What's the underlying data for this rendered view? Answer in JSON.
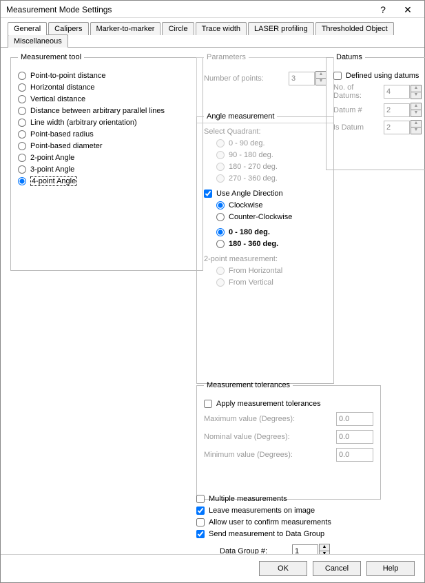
{
  "window": {
    "title": "Measurement Mode Settings",
    "help": "?",
    "close": "✕"
  },
  "tabs": [
    "General",
    "Calipers",
    "Marker-to-marker",
    "Circle",
    "Trace width",
    "LASER profiling",
    "Thresholded Object",
    "Miscellaneous"
  ],
  "tool": {
    "legend": "Measurement tool",
    "options": [
      "Point-to-point distance",
      "Horizontal distance",
      "Vertical distance",
      "Distance between arbitrary parallel lines",
      "Line width (arbitrary orientation)",
      "Point-based radius",
      "Point-based diameter",
      "2-point Angle",
      "3-point Angle",
      "4-point Angle"
    ],
    "selected": "4-point Angle"
  },
  "params": {
    "legend": "Parameters",
    "num_points_label": "Number of points:",
    "num_points": "3"
  },
  "datums": {
    "legend": "Datums",
    "use_label": "Defined using datums",
    "rows": [
      {
        "label": "No. of Datums:",
        "value": "4"
      },
      {
        "label": "Datum #",
        "value": "2"
      },
      {
        "label": "Is Datum",
        "value": "2"
      }
    ]
  },
  "angle": {
    "legend": "Angle measurement",
    "quadrant_label": "Select Quadrant:",
    "quadrants": [
      "0 - 90 deg.",
      "90 - 180 deg.",
      "180 - 270 deg.",
      "270 - 360 deg."
    ],
    "use_dir_label": "Use Angle Direction",
    "use_dir": true,
    "dir_options": [
      "Clockwise",
      "Counter-Clockwise"
    ],
    "dir_selected": "Clockwise",
    "range_options": [
      "0 - 180 deg.",
      "180 - 360 deg."
    ],
    "range_selected": "0 - 180 deg.",
    "two_pt_label": "2-point measurement:",
    "two_pt_options": [
      "From Horizontal",
      "From Vertical"
    ]
  },
  "tol": {
    "legend": "Measurement tolerances",
    "apply_label": "Apply measurement tolerances",
    "rows": [
      {
        "label": "Maximum value (Degrees):",
        "value": "0.0"
      },
      {
        "label": "Nominal value (Degrees):",
        "value": "0.0"
      },
      {
        "label": "Minimum value (Degrees):",
        "value": "0.0"
      }
    ]
  },
  "checks": {
    "multiple": "Multiple measurements",
    "leave": "Leave measurements on image",
    "confirm": "Allow user to confirm measurements",
    "send": "Send measurement to Data Group",
    "group_label": "Data Group #:",
    "group_value": "1"
  },
  "footer": {
    "ok": "OK",
    "cancel": "Cancel",
    "help": "Help"
  }
}
